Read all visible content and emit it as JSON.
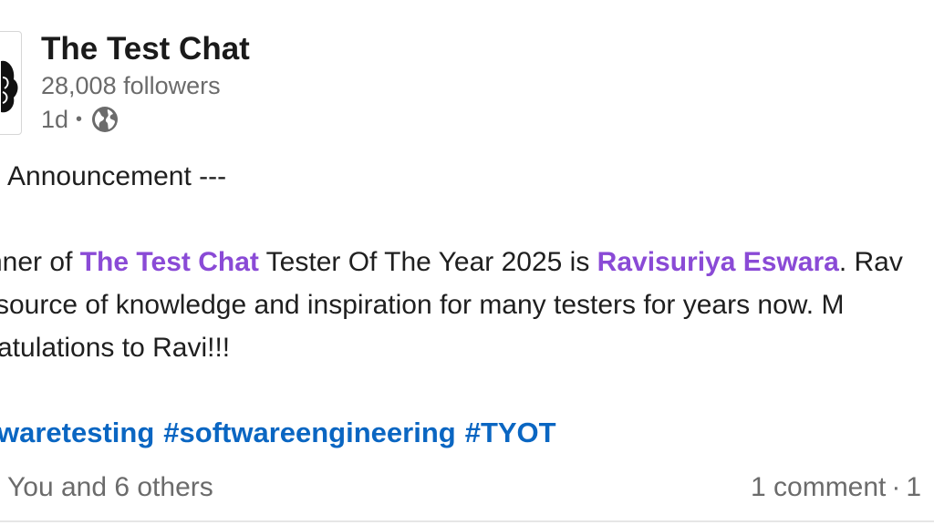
{
  "post": {
    "author": {
      "name": "The Test Chat",
      "followers": "28,008 followers",
      "time": "1d",
      "separator": "•",
      "visibility_icon": "globe-icon"
    },
    "body": {
      "line1": "Announcement ---",
      "line2": {
        "part1": "nner of ",
        "mention1": "The Test Chat",
        "part2": " Tester Of The Year 2025 is ",
        "mention2": "Ravisuriya Eswara",
        "part3": ". Rav"
      },
      "line3": "source of knowledge and inspiration for many testers for years now. M",
      "line4": "atulations to Ravi!!!"
    },
    "hashtags": [
      "waretesting",
      "#softwareengineering",
      "#TYOT"
    ],
    "footer": {
      "reactions": "You and 6 others",
      "comments": "1 comment",
      "separator": "·",
      "reposts_partial": "1"
    }
  },
  "colors": {
    "mention": "#8a4ad6",
    "hashtag": "#0a66c2",
    "muted": "#6b6b6b",
    "text": "#1f1f1f"
  }
}
